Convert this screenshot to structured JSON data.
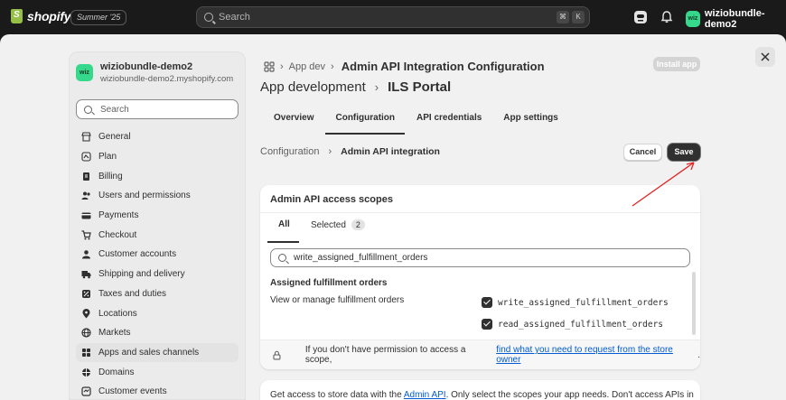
{
  "topbar": {
    "logo_text": "shopify",
    "edition": "Summer '25",
    "search_placeholder": "Search",
    "kbd1": "⌘",
    "kbd2": "K",
    "store_initials": "wiz",
    "store_name": "wiziobundle-demo2"
  },
  "sidebar": {
    "shop_initials": "wiz",
    "shop_name": "wiziobundle-demo2",
    "shop_url": "wiziobundle-demo2.myshopify.com",
    "search_placeholder": "Search",
    "items": [
      {
        "label": "General",
        "icon": "store-icon"
      },
      {
        "label": "Plan",
        "icon": "plan-icon"
      },
      {
        "label": "Billing",
        "icon": "billing-icon"
      },
      {
        "label": "Users and permissions",
        "icon": "users-icon"
      },
      {
        "label": "Payments",
        "icon": "payments-icon"
      },
      {
        "label": "Checkout",
        "icon": "cart-icon"
      },
      {
        "label": "Customer accounts",
        "icon": "person-icon"
      },
      {
        "label": "Shipping and delivery",
        "icon": "truck-icon"
      },
      {
        "label": "Taxes and duties",
        "icon": "tax-icon"
      },
      {
        "label": "Locations",
        "icon": "location-icon"
      },
      {
        "label": "Markets",
        "icon": "globe-icon"
      },
      {
        "label": "Apps and sales channels",
        "icon": "apps-icon"
      },
      {
        "label": "Domains",
        "icon": "domain-icon"
      },
      {
        "label": "Customer events",
        "icon": "events-icon"
      }
    ],
    "active_index": 11
  },
  "header": {
    "crumb_short": "App dev",
    "crumb_title": "Admin API Integration Configuration",
    "install_label": "Install app",
    "title_part1": "App development",
    "title_part2": "ILS Portal"
  },
  "tabs": [
    "Overview",
    "Configuration",
    "API credentials",
    "App settings"
  ],
  "active_tab": 1,
  "subcrumb": {
    "parent": "Configuration",
    "current": "Admin API integration"
  },
  "actions": {
    "cancel": "Cancel",
    "save": "Save"
  },
  "scopes_card": {
    "title": "Admin API access scopes",
    "tab_all": "All",
    "tab_selected": "Selected",
    "selected_count": "2",
    "filter_value": "write_assigned_fulfillment_orders",
    "group_title": "Assigned fulfillment orders",
    "group_desc": "View or manage fulfillment orders",
    "scopes": [
      {
        "name": "write_assigned_fulfillment_orders",
        "checked": true
      },
      {
        "name": "read_assigned_fulfillment_orders",
        "checked": true
      }
    ],
    "notice_text": "If you don't have permission to access a scope,",
    "notice_link": "find what you need to request from the store owner",
    "notice_end": "."
  },
  "card2": {
    "text_before": "Get access to store data with the",
    "link": "Admin API",
    "text_after": ". Only select the scopes your app needs. Don't access APIs in"
  },
  "annotation_color": "#e02424"
}
